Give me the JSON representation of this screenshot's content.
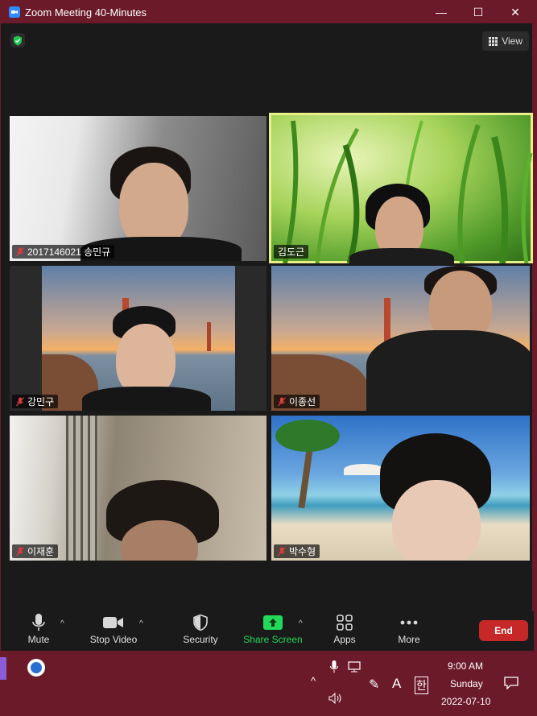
{
  "window": {
    "title": "Zoom Meeting 40-Minutes",
    "minimize": "—",
    "maximize": "☐",
    "close": "✕"
  },
  "topbar": {
    "view_label": "View"
  },
  "participants": [
    {
      "name": "2017146021 송민규",
      "muted": true,
      "active": false
    },
    {
      "name": "김도근",
      "muted": false,
      "active": true
    },
    {
      "name": "강민구",
      "muted": true,
      "active": false
    },
    {
      "name": "이종선",
      "muted": true,
      "active": false
    },
    {
      "name": "이재훈",
      "muted": true,
      "active": false
    },
    {
      "name": "박수형",
      "muted": true,
      "active": false
    }
  ],
  "toolbar": {
    "mute": "Mute",
    "stop_video": "Stop Video",
    "security": "Security",
    "share_screen": "Share Screen",
    "apps": "Apps",
    "more": "More",
    "end": "End"
  },
  "colors": {
    "window_frame": "#6b1a2a",
    "share_green": "#23d959",
    "end_red": "#c62828",
    "active_speaker": "#e9f08a"
  },
  "taskbar": {
    "time": "9:00 AM",
    "day": "Sunday",
    "date": "2022-07-10",
    "ime_a": "A",
    "ime_han": "한"
  }
}
